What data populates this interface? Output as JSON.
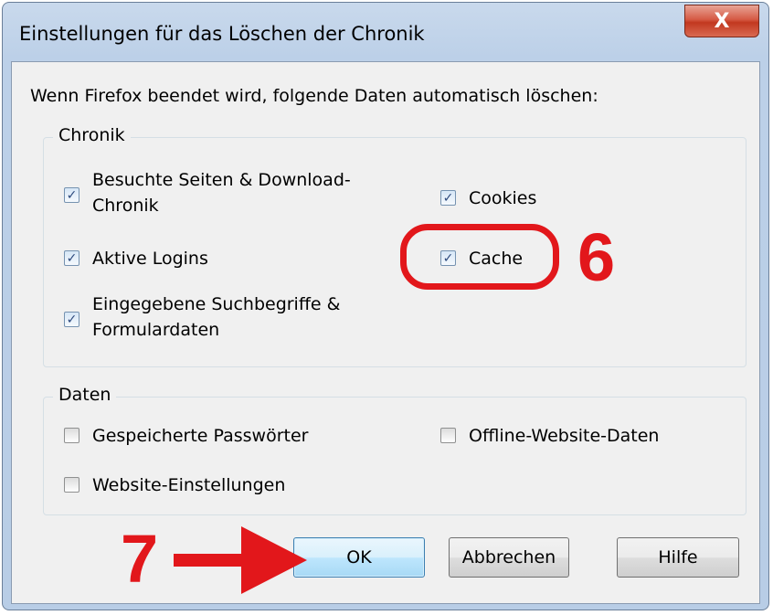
{
  "window": {
    "title": "Einstellungen für das Löschen der Chronik",
    "close_label": "X"
  },
  "intro_text": "Wenn Firefox beendet wird, folgende Daten automatisch löschen:",
  "groups": {
    "chronik": {
      "legend": "Chronik",
      "items": [
        {
          "line1": "Besuchte Seiten & Download-",
          "line2": "Chronik",
          "checked": true
        },
        {
          "label": "Aktive Logins",
          "checked": true
        },
        {
          "line1": "Eingegebene Suchbegriffe &",
          "line2": "Formulardaten",
          "checked": true
        },
        {
          "label": "Cookies",
          "checked": true
        },
        {
          "label": "Cache",
          "checked": true
        }
      ]
    },
    "daten": {
      "legend": "Daten",
      "items": [
        {
          "label": "Gespeicherte Passwörter",
          "checked": false
        },
        {
          "label": "Website-Einstellungen",
          "checked": false
        },
        {
          "label": "Offline-Website-Daten",
          "checked": false
        }
      ]
    }
  },
  "buttons": {
    "ok": "OK",
    "cancel": "Abbrechen",
    "help": "Hilfe"
  },
  "annotations": {
    "step6": "6",
    "step7": "7",
    "color": "#e2171b"
  }
}
